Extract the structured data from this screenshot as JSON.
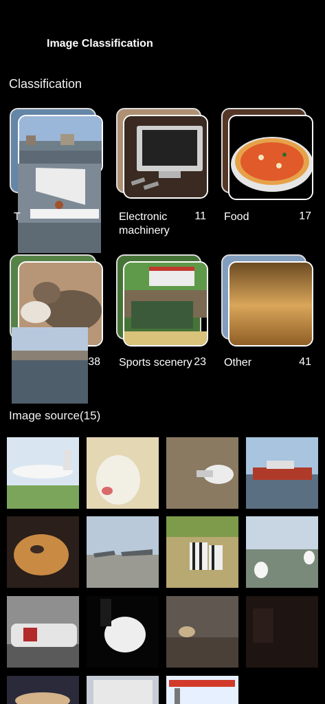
{
  "app": {
    "title": "Image Classification"
  },
  "classification": {
    "title": "Classification",
    "categories": [
      {
        "label": "T",
        "count": ""
      },
      {
        "label": "Electronic machinery",
        "count": "11"
      },
      {
        "label": "Food",
        "count": "17"
      },
      {
        "label": "",
        "count": "38"
      },
      {
        "label": "Sports scenery",
        "count": "23"
      },
      {
        "label": "Other",
        "count": "41"
      }
    ]
  },
  "image_source": {
    "title": "Image source(15)",
    "thumbnails": [
      "airplane",
      "sheep",
      "seagull",
      "boat",
      "dog",
      "jets",
      "zebras",
      "geese",
      "race-car",
      "horse",
      "birds",
      "dark-room",
      "dog-partial",
      "building",
      "gas-station"
    ]
  }
}
